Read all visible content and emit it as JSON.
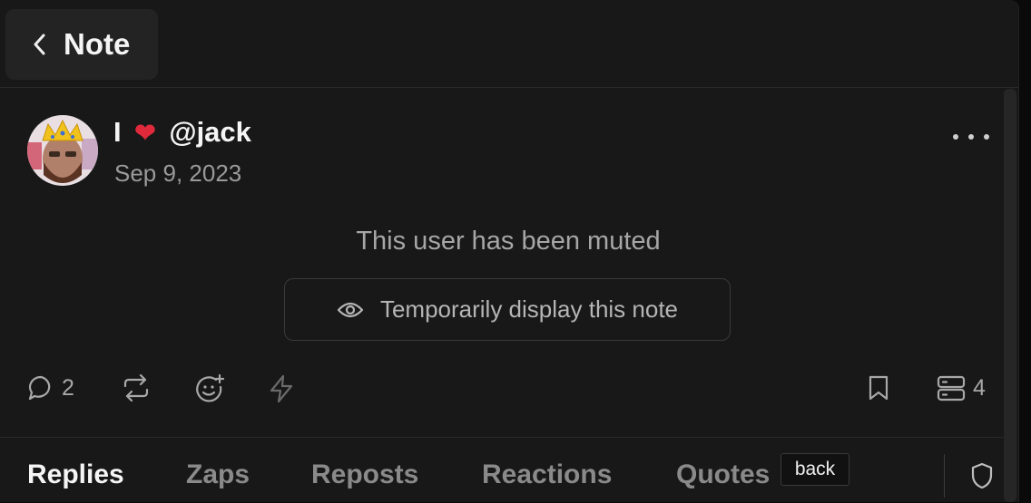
{
  "header": {
    "title": "Note",
    "back_icon": "chevron-left-icon"
  },
  "note": {
    "author": {
      "name_prefix": "I",
      "heart": "❤",
      "name_suffix": "@jack"
    },
    "date": "Sep 9, 2023",
    "muted_message": "This user has been muted",
    "reveal_label": "Temporarily display this note"
  },
  "actions": {
    "replies": {
      "icon": "comment-icon",
      "count": "2"
    },
    "repost": {
      "icon": "repost-icon"
    },
    "react": {
      "icon": "add-reaction-icon"
    },
    "zap": {
      "icon": "lightning-icon"
    },
    "bookmark": {
      "icon": "bookmark-icon"
    },
    "relays": {
      "icon": "server-icon",
      "count": "4"
    }
  },
  "tabs": [
    {
      "label": "Replies",
      "active": true
    },
    {
      "label": "Zaps"
    },
    {
      "label": "Reposts"
    },
    {
      "label": "Reactions"
    },
    {
      "label": "Quotes"
    }
  ],
  "tooltip": "back",
  "colors": {
    "background": "#181818",
    "accent_heart": "#e02a3b",
    "muted_text": "#a6a6a6"
  }
}
